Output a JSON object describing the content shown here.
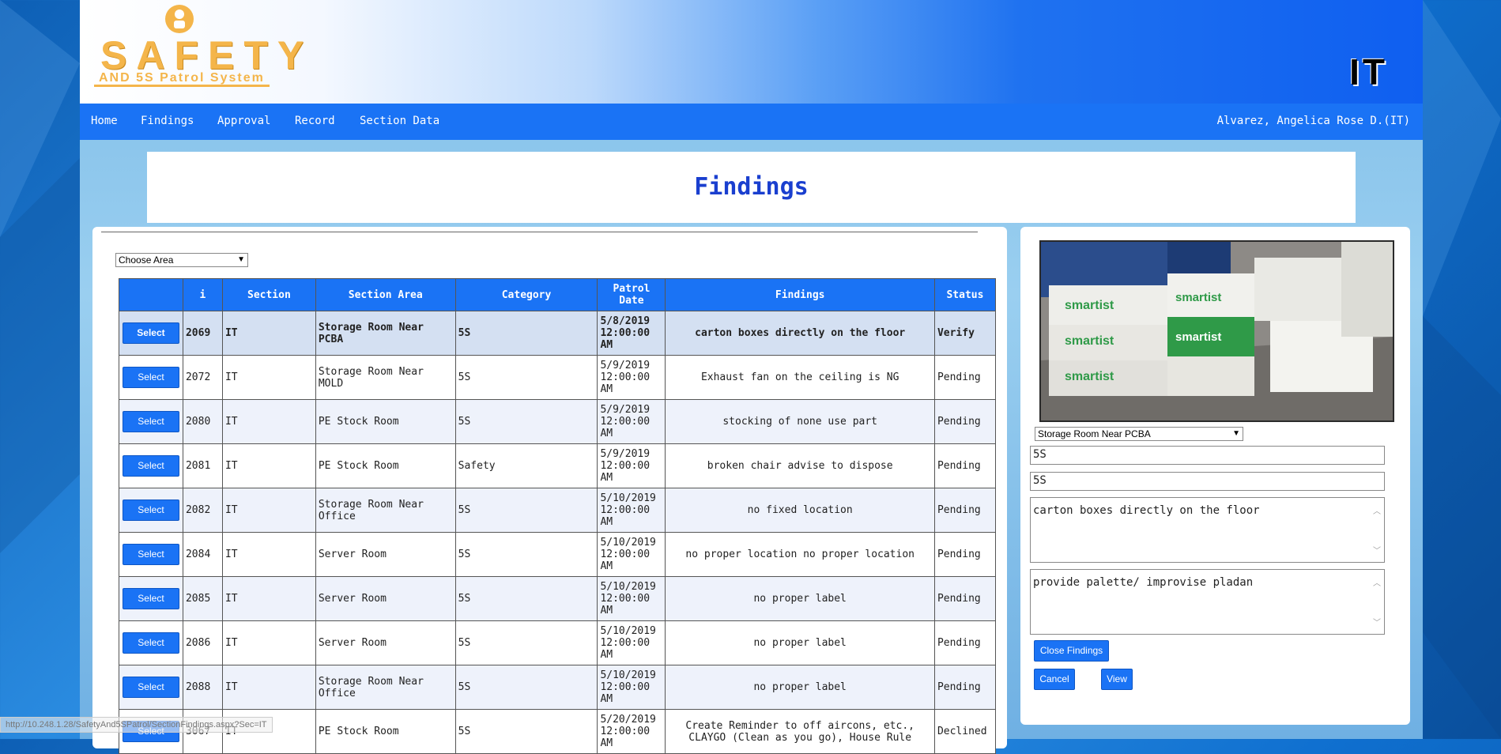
{
  "header": {
    "logo_title": "SAFETY",
    "logo_subtitle": "AND 5S Patrol System",
    "department": "IT"
  },
  "nav": {
    "items": [
      "Home",
      "Findings",
      "Approval",
      "Record",
      "Section Data"
    ],
    "user": "Alvarez, Angelica Rose D.(IT)"
  },
  "page_title": "Findings",
  "filter": {
    "area_placeholder": "Choose Area"
  },
  "table": {
    "headers": [
      "",
      "i",
      "Section",
      "Section Area",
      "Category",
      "Patrol Date",
      "Findings",
      "Status"
    ],
    "select_label": "Select",
    "rows": [
      {
        "id": "2069",
        "section": "IT",
        "area": "Storage Room Near PCBA",
        "category": "5S",
        "date": "5/8/2019 12:00:00 AM",
        "finding": "carton boxes directly on the floor",
        "status": "Verify"
      },
      {
        "id": "2072",
        "section": "IT",
        "area": "Storage Room Near MOLD",
        "category": "5S",
        "date": "5/9/2019 12:00:00 AM",
        "finding": "Exhaust fan on the ceiling is NG",
        "status": "Pending"
      },
      {
        "id": "2080",
        "section": "IT",
        "area": "PE Stock Room",
        "category": "5S",
        "date": "5/9/2019 12:00:00 AM",
        "finding": "stocking of none use part",
        "status": "Pending"
      },
      {
        "id": "2081",
        "section": "IT",
        "area": "PE Stock Room",
        "category": "Safety",
        "date": "5/9/2019 12:00:00 AM",
        "finding": "broken chair advise to dispose",
        "status": "Pending"
      },
      {
        "id": "2082",
        "section": "IT",
        "area": "Storage Room Near Office",
        "category": "5S",
        "date": "5/10/2019 12:00:00 AM",
        "finding": "no fixed location",
        "status": "Pending"
      },
      {
        "id": "2084",
        "section": "IT",
        "area": "Server Room",
        "category": "5S",
        "date": "5/10/2019 12:00:00 AM",
        "finding": "no proper location no proper location",
        "status": "Pending"
      },
      {
        "id": "2085",
        "section": "IT",
        "area": "Server Room",
        "category": "5S",
        "date": "5/10/2019 12:00:00 AM",
        "finding": "no proper label",
        "status": "Pending"
      },
      {
        "id": "2086",
        "section": "IT",
        "area": "Server Room",
        "category": "5S",
        "date": "5/10/2019 12:00:00 AM",
        "finding": "no proper label",
        "status": "Pending"
      },
      {
        "id": "2088",
        "section": "IT",
        "area": "Storage Room Near Office",
        "category": "5S",
        "date": "5/10/2019 12:00:00 AM",
        "finding": "no proper label",
        "status": "Pending"
      },
      {
        "id": "3067",
        "section": "IT",
        "area": "PE Stock Room",
        "category": "5S",
        "date": "5/20/2019 12:00:00 AM",
        "finding": "Create Reminder to off aircons, etc., CLAYGO (Clean as you go), House Rule",
        "status": "Declined"
      }
    ]
  },
  "detail": {
    "area_selected": "Storage Room Near PCBA",
    "category_1": "5S",
    "category_2": "5S",
    "finding": "carton boxes directly on the floor",
    "countermeasure": "provide palette/ improvise pladan",
    "close_label": "Close Findings",
    "cancel_label": "Cancel",
    "view_label": "View",
    "photo_box_text": "smartist"
  },
  "status_bar": "http://10.248.1.28/SafetyAnd5SPatrol/SectionFindings.aspx?Sec=IT",
  "colors": {
    "nav": "#1a73f5",
    "title": "#1a3fcf",
    "logo": "#f4b54a"
  }
}
